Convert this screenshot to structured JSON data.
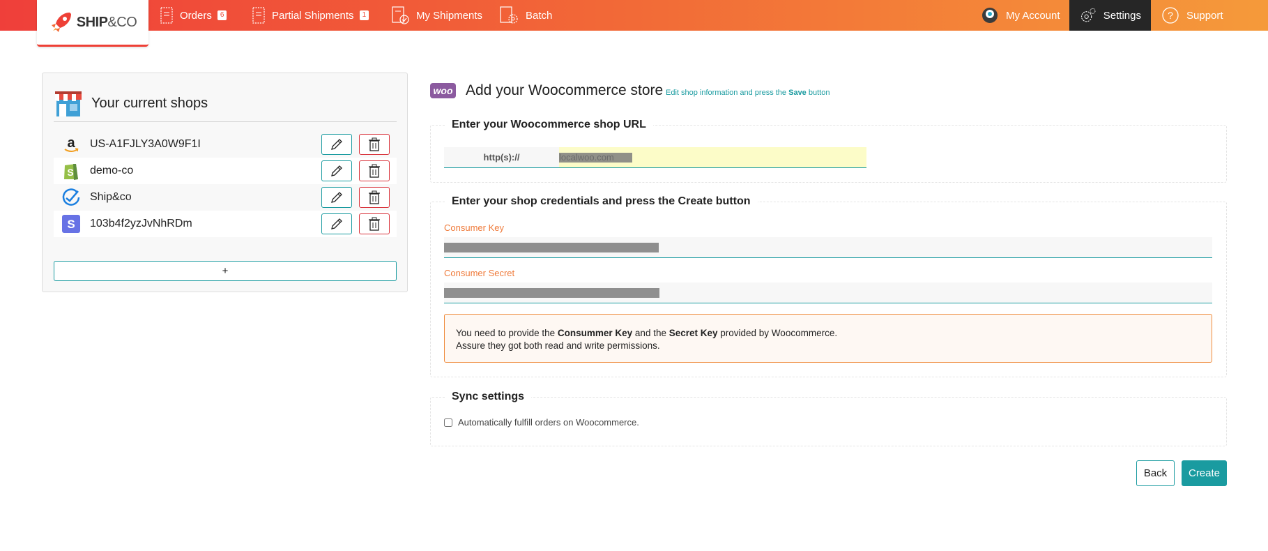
{
  "nav": {
    "brand": "SHIP",
    "brand_amp": "&",
    "brand_suffix": "CO",
    "items": [
      {
        "label": "Orders",
        "badge": "6"
      },
      {
        "label": "Partial Shipments",
        "badge": "1"
      },
      {
        "label": "My Shipments"
      },
      {
        "label": "Batch"
      }
    ],
    "right": [
      {
        "label": "My Account"
      },
      {
        "label": "Settings"
      },
      {
        "label": "Support"
      }
    ]
  },
  "shops": {
    "title": "Your current shops",
    "items": [
      {
        "name": "US-A1FJLY3A0W9F1I",
        "icon": "amazon-icon"
      },
      {
        "name": "demo-co",
        "icon": "shopify-icon"
      },
      {
        "name": "Ship&co",
        "icon": "shipandco-icon"
      },
      {
        "name": "103b4f2yzJvNhRDm",
        "icon": "stripe-icon"
      }
    ],
    "add_label": "+"
  },
  "woo": {
    "logo": "woo",
    "title": "Add your Woocommerce store",
    "sub_pre": "Edit shop information and press the ",
    "sub_bold": "Save",
    "sub_post": " button",
    "url_legend": "Enter your Woocommerce shop URL",
    "url_prefix": "http(s)://",
    "url_value": "localwoo.com",
    "cred_legend": "Enter your shop credentials and press the Create button",
    "consumer_key_label": "Consumer Key",
    "consumer_secret_label": "Consumer Secret",
    "alert_1_pre": "You need to provide the ",
    "alert_1_b1": "Consummer Key",
    "alert_1_mid": " and the ",
    "alert_1_b2": "Secret Key",
    "alert_1_post": " provided by Woocommerce.",
    "alert_2": "Assure they got both read and write permissions.",
    "sync_legend": "Sync settings",
    "sync_checkbox_label": "Automatically fulfill orders on Woocommerce.",
    "back_label": "Back",
    "create_label": "Create"
  },
  "colors": {
    "accent": "#1a9ba0",
    "danger": "#d9363e",
    "orange": "#ef7a3a"
  }
}
